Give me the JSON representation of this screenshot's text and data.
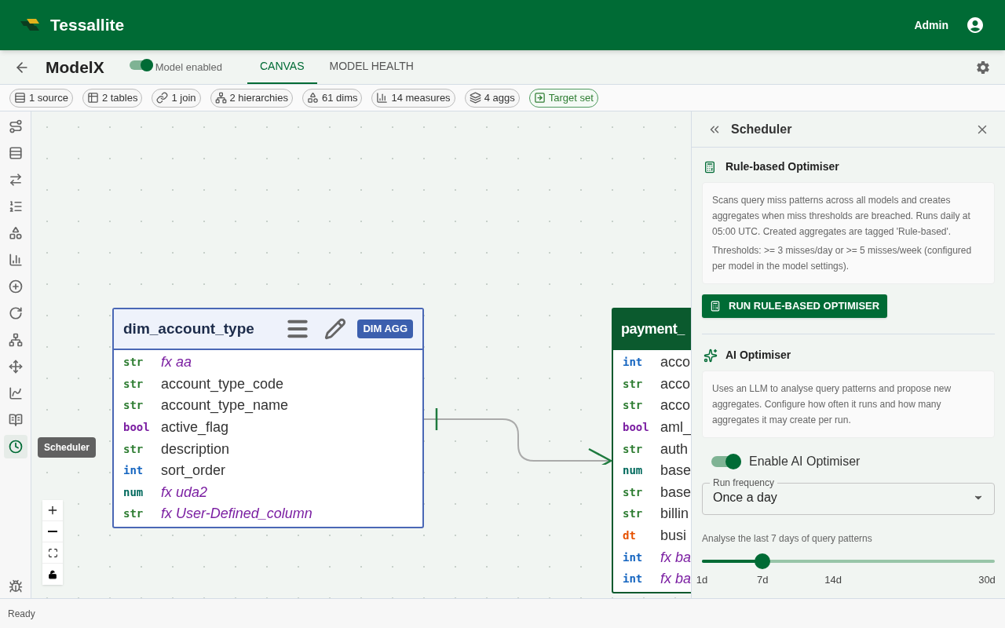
{
  "app": {
    "brand": "Tessallite",
    "user": "Admin"
  },
  "model": {
    "name": "ModelX",
    "enabled_label": "Model enabled",
    "enabled": true
  },
  "tabs": [
    {
      "label": "CANVAS",
      "selected": true
    },
    {
      "label": "MODEL HEALTH",
      "selected": false
    }
  ],
  "chips": [
    {
      "kind": "source",
      "label": "1 source"
    },
    {
      "kind": "tables",
      "label": "2 tables"
    },
    {
      "kind": "join",
      "label": "1 join"
    },
    {
      "kind": "hierarchy",
      "label": "2 hierarchies"
    },
    {
      "kind": "dims",
      "label": "61 dims"
    },
    {
      "kind": "measures",
      "label": "14 measures"
    },
    {
      "kind": "aggs",
      "label": "4 aggs"
    },
    {
      "kind": "target",
      "label": "Target set"
    }
  ],
  "sidebar": {
    "items": [
      {
        "kind": "route",
        "selected": false
      },
      {
        "kind": "rows",
        "selected": false
      },
      {
        "kind": "arrows",
        "selected": false
      },
      {
        "kind": "ordered",
        "selected": false
      },
      {
        "kind": "shapes",
        "selected": false
      },
      {
        "kind": "bars",
        "selected": false
      },
      {
        "kind": "plus",
        "selected": false
      },
      {
        "kind": "refresh",
        "selected": false
      },
      {
        "kind": "tree",
        "selected": false
      },
      {
        "kind": "move",
        "selected": false
      },
      {
        "kind": "chartsearch",
        "selected": false
      },
      {
        "kind": "book",
        "selected": false
      },
      {
        "kind": "clock",
        "selected": true
      }
    ],
    "tooltip": "Scheduler"
  },
  "canvas": {
    "tables": [
      {
        "kind": "dimension",
        "name": "dim_account_type",
        "badge": "DIM AGG",
        "columns": [
          {
            "type": "str",
            "name": "fx aa",
            "computed": true
          },
          {
            "type": "str",
            "name": "account_type_code",
            "computed": false
          },
          {
            "type": "str",
            "name": "account_type_name",
            "computed": false
          },
          {
            "type": "bool",
            "name": "active_flag",
            "computed": false
          },
          {
            "type": "str",
            "name": "description",
            "computed": false
          },
          {
            "type": "int",
            "name": "sort_order",
            "computed": false
          },
          {
            "type": "num",
            "name": "fx uda2",
            "computed": true
          },
          {
            "type": "str",
            "name": "fx User-Defined_column",
            "computed": true
          }
        ]
      },
      {
        "kind": "fact",
        "name": "payment_",
        "columns": [
          {
            "type": "int",
            "name": "acco",
            "computed": false
          },
          {
            "type": "str",
            "name": "acco",
            "computed": false
          },
          {
            "type": "str",
            "name": "acco",
            "computed": false
          },
          {
            "type": "bool",
            "name": "aml_",
            "computed": false
          },
          {
            "type": "str",
            "name": "auth",
            "computed": false
          },
          {
            "type": "num",
            "name": "base",
            "computed": false
          },
          {
            "type": "str",
            "name": "base",
            "computed": false
          },
          {
            "type": "str",
            "name": "billin",
            "computed": false
          },
          {
            "type": "dt",
            "name": "busi",
            "computed": false
          },
          {
            "type": "int",
            "name": "fx ba",
            "computed": true
          },
          {
            "type": "int",
            "name": "fx ba",
            "computed": true
          }
        ]
      }
    ]
  },
  "panel": {
    "title": "Scheduler",
    "rule": {
      "title": "Rule-based Optimiser",
      "paragraphs": [
        "Scans query miss patterns across all models and creates aggregates when miss thresholds are breached. Runs daily at 05:00 UTC. Created aggregates are tagged 'Rule-based'.",
        "Thresholds: >= 3 misses/day or >= 5 misses/week (configured per model in the model settings)."
      ],
      "button": "RUN RULE-BASED OPTIMISER"
    },
    "ai": {
      "title": "AI Optimiser",
      "description": "Uses an LLM to analyse query patterns and propose new aggregates. Configure how often it runs and how many aggregates it may create per run.",
      "toggle_label": "Enable AI Optimiser",
      "enabled": true,
      "frequency": {
        "label": "Run frequency",
        "value": "Once a day"
      },
      "window": {
        "label": "Analyse the last 7 days of query patterns",
        "level": 0.207,
        "marks": [
          "1d",
          "7d",
          "14d",
          "30d"
        ]
      }
    }
  },
  "status_bar": "Ready"
}
